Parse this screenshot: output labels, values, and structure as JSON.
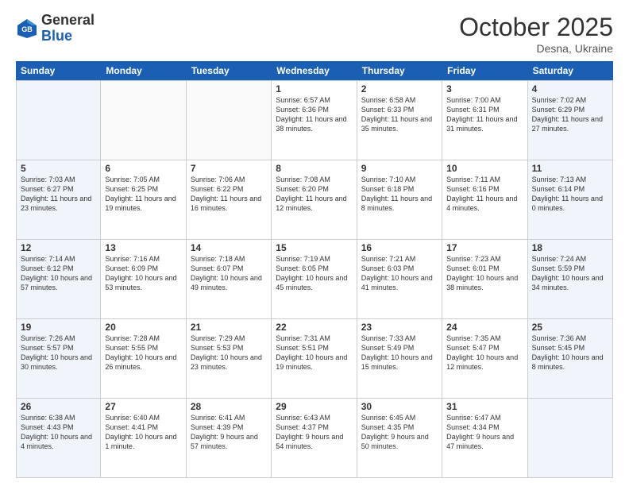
{
  "header": {
    "logo_general": "General",
    "logo_blue": "Blue",
    "month_title": "October 2025",
    "location": "Desna, Ukraine"
  },
  "days_of_week": [
    "Sunday",
    "Monday",
    "Tuesday",
    "Wednesday",
    "Thursday",
    "Friday",
    "Saturday"
  ],
  "weeks": [
    [
      {
        "day": "",
        "info": ""
      },
      {
        "day": "",
        "info": ""
      },
      {
        "day": "",
        "info": ""
      },
      {
        "day": "1",
        "info": "Sunrise: 6:57 AM\nSunset: 6:36 PM\nDaylight: 11 hours\nand 38 minutes."
      },
      {
        "day": "2",
        "info": "Sunrise: 6:58 AM\nSunset: 6:33 PM\nDaylight: 11 hours\nand 35 minutes."
      },
      {
        "day": "3",
        "info": "Sunrise: 7:00 AM\nSunset: 6:31 PM\nDaylight: 11 hours\nand 31 minutes."
      },
      {
        "day": "4",
        "info": "Sunrise: 7:02 AM\nSunset: 6:29 PM\nDaylight: 11 hours\nand 27 minutes."
      }
    ],
    [
      {
        "day": "5",
        "info": "Sunrise: 7:03 AM\nSunset: 6:27 PM\nDaylight: 11 hours\nand 23 minutes."
      },
      {
        "day": "6",
        "info": "Sunrise: 7:05 AM\nSunset: 6:25 PM\nDaylight: 11 hours\nand 19 minutes."
      },
      {
        "day": "7",
        "info": "Sunrise: 7:06 AM\nSunset: 6:22 PM\nDaylight: 11 hours\nand 16 minutes."
      },
      {
        "day": "8",
        "info": "Sunrise: 7:08 AM\nSunset: 6:20 PM\nDaylight: 11 hours\nand 12 minutes."
      },
      {
        "day": "9",
        "info": "Sunrise: 7:10 AM\nSunset: 6:18 PM\nDaylight: 11 hours\nand 8 minutes."
      },
      {
        "day": "10",
        "info": "Sunrise: 7:11 AM\nSunset: 6:16 PM\nDaylight: 11 hours\nand 4 minutes."
      },
      {
        "day": "11",
        "info": "Sunrise: 7:13 AM\nSunset: 6:14 PM\nDaylight: 11 hours\nand 0 minutes."
      }
    ],
    [
      {
        "day": "12",
        "info": "Sunrise: 7:14 AM\nSunset: 6:12 PM\nDaylight: 10 hours\nand 57 minutes."
      },
      {
        "day": "13",
        "info": "Sunrise: 7:16 AM\nSunset: 6:09 PM\nDaylight: 10 hours\nand 53 minutes."
      },
      {
        "day": "14",
        "info": "Sunrise: 7:18 AM\nSunset: 6:07 PM\nDaylight: 10 hours\nand 49 minutes."
      },
      {
        "day": "15",
        "info": "Sunrise: 7:19 AM\nSunset: 6:05 PM\nDaylight: 10 hours\nand 45 minutes."
      },
      {
        "day": "16",
        "info": "Sunrise: 7:21 AM\nSunset: 6:03 PM\nDaylight: 10 hours\nand 41 minutes."
      },
      {
        "day": "17",
        "info": "Sunrise: 7:23 AM\nSunset: 6:01 PM\nDaylight: 10 hours\nand 38 minutes."
      },
      {
        "day": "18",
        "info": "Sunrise: 7:24 AM\nSunset: 5:59 PM\nDaylight: 10 hours\nand 34 minutes."
      }
    ],
    [
      {
        "day": "19",
        "info": "Sunrise: 7:26 AM\nSunset: 5:57 PM\nDaylight: 10 hours\nand 30 minutes."
      },
      {
        "day": "20",
        "info": "Sunrise: 7:28 AM\nSunset: 5:55 PM\nDaylight: 10 hours\nand 26 minutes."
      },
      {
        "day": "21",
        "info": "Sunrise: 7:29 AM\nSunset: 5:53 PM\nDaylight: 10 hours\nand 23 minutes."
      },
      {
        "day": "22",
        "info": "Sunrise: 7:31 AM\nSunset: 5:51 PM\nDaylight: 10 hours\nand 19 minutes."
      },
      {
        "day": "23",
        "info": "Sunrise: 7:33 AM\nSunset: 5:49 PM\nDaylight: 10 hours\nand 15 minutes."
      },
      {
        "day": "24",
        "info": "Sunrise: 7:35 AM\nSunset: 5:47 PM\nDaylight: 10 hours\nand 12 minutes."
      },
      {
        "day": "25",
        "info": "Sunrise: 7:36 AM\nSunset: 5:45 PM\nDaylight: 10 hours\nand 8 minutes."
      }
    ],
    [
      {
        "day": "26",
        "info": "Sunrise: 6:38 AM\nSunset: 4:43 PM\nDaylight: 10 hours\nand 4 minutes."
      },
      {
        "day": "27",
        "info": "Sunrise: 6:40 AM\nSunset: 4:41 PM\nDaylight: 10 hours\nand 1 minute."
      },
      {
        "day": "28",
        "info": "Sunrise: 6:41 AM\nSunset: 4:39 PM\nDaylight: 9 hours\nand 57 minutes."
      },
      {
        "day": "29",
        "info": "Sunrise: 6:43 AM\nSunset: 4:37 PM\nDaylight: 9 hours\nand 54 minutes."
      },
      {
        "day": "30",
        "info": "Sunrise: 6:45 AM\nSunset: 4:35 PM\nDaylight: 9 hours\nand 50 minutes."
      },
      {
        "day": "31",
        "info": "Sunrise: 6:47 AM\nSunset: 4:34 PM\nDaylight: 9 hours\nand 47 minutes."
      },
      {
        "day": "",
        "info": ""
      }
    ]
  ]
}
